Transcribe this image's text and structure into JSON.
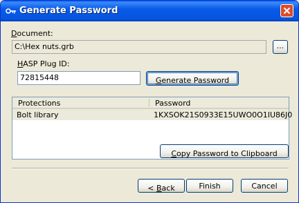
{
  "window": {
    "title": "Generate Password",
    "title_icon": "key-icon",
    "close_icon": "close-icon"
  },
  "document": {
    "label_accel": "D",
    "label_rest": "ocument:",
    "value": "C:\\Hex nuts.grb",
    "browse_label": "..."
  },
  "hasp": {
    "label_accel": "H",
    "label_rest": "ASP Plug ID:",
    "value": "72815448"
  },
  "generate_button": {
    "label_accel": "G",
    "label_rest": "enerate Password"
  },
  "table": {
    "columns": [
      "Protections",
      "Password"
    ],
    "rows": [
      {
        "protection": "Bolt library",
        "password": "1KXSOK21S0933E15UWO0O1IU86J0",
        "selected": true
      }
    ]
  },
  "copy_button": {
    "label_accel": "C",
    "label_rest": "opy Password to Clipboard"
  },
  "footer": {
    "back_prefix": "< ",
    "back_accel": "B",
    "back_rest": "ack",
    "finish_label": "Finish",
    "cancel_label": "Cancel"
  },
  "colors": {
    "titlebar": "#0a5ae8",
    "dialog_bg": "#ece9d8",
    "close": "#e04a26"
  }
}
